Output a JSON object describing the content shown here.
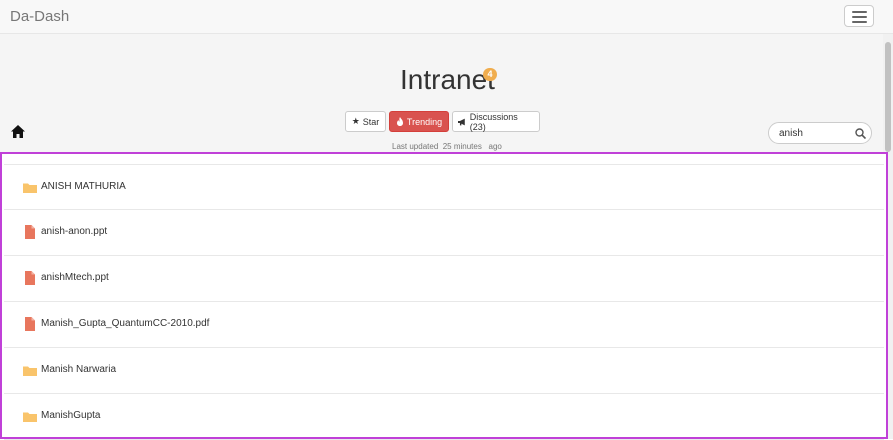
{
  "navbar": {
    "brand": "Da-Dash"
  },
  "header": {
    "title": "Intranet",
    "badge_count": "4",
    "buttons": {
      "star_label": "Star",
      "trending_label": "Trending",
      "discussions_label": "Discussions (23)"
    },
    "last_updated": "Last updated  25 minutes   ago"
  },
  "search": {
    "value": "anish"
  },
  "files": [
    {
      "name": "ANISH MATHURIA",
      "type": "folder"
    },
    {
      "name": "anish-anon.ppt",
      "type": "file"
    },
    {
      "name": "anishMtech.ppt",
      "type": "file"
    },
    {
      "name": "Manish_Gupta_QuantumCC-2010.pdf",
      "type": "file"
    },
    {
      "name": "Manish Narwaria",
      "type": "folder"
    },
    {
      "name": "ManishGupta",
      "type": "folder"
    }
  ],
  "colors": {
    "folder": "#f9c46b",
    "file": "#e8765d",
    "trending": "#d9534f",
    "badge": "#f0ad4e",
    "highlight_border": "#c040d8"
  },
  "icons": [
    "home-icon",
    "search-icon",
    "star-icon",
    "fire-icon",
    "megaphone-icon",
    "folder-icon",
    "file-icon",
    "menu-icon"
  ]
}
